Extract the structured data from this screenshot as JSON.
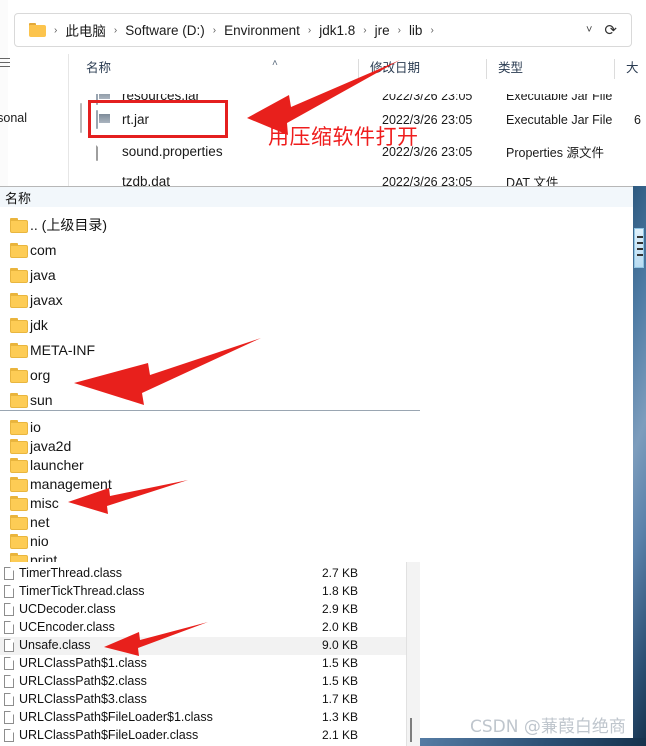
{
  "explorer": {
    "address": {
      "folder_icon": "folder-icon",
      "crumbs": [
        "此电脑",
        "Software (D:)",
        "Environment",
        "jdk1.8",
        "jre",
        "lib"
      ],
      "separator": "›",
      "dropdown_icon": "chevron-down-icon",
      "refresh_icon": "refresh-icon"
    },
    "nav_pane": {
      "hamburger_icon": "hamburger-icon",
      "partial_label": "ersonal"
    },
    "columns": [
      {
        "label": "名称",
        "sort_caret": "˄"
      },
      {
        "label": "修改日期"
      },
      {
        "label": "类型"
      },
      {
        "label": "大"
      }
    ],
    "rows": [
      {
        "icon": "jar-file-icon",
        "name": "resources.jar",
        "date": "2022/3/26 23:05",
        "type": "Executable Jar File",
        "size": ""
      },
      {
        "icon": "jar-file-icon",
        "name": "rt.jar",
        "date": "2022/3/26 23:05",
        "type": "Executable Jar File",
        "size": "6"
      },
      {
        "icon": "document-icon",
        "name": "sound.properties",
        "date": "2022/3/26 23:05",
        "type": "Properties 源文件",
        "size": ""
      },
      {
        "icon": "blue-globe-icon",
        "name": "tzdb.dat",
        "date": "2022/3/26 23:05",
        "type": "DAT 文件",
        "size": ""
      }
    ]
  },
  "annotation": {
    "text": "用压缩软件打开",
    "color": "#ef1d1d",
    "highlight_box_target": "rt.jar"
  },
  "archive_root": {
    "header": "名称",
    "items": [
      {
        "icon": "folder-icon",
        "name": ".. (上级目录)"
      },
      {
        "icon": "folder-icon",
        "name": "com"
      },
      {
        "icon": "folder-icon",
        "name": "java"
      },
      {
        "icon": "folder-icon",
        "name": "javax"
      },
      {
        "icon": "folder-icon",
        "name": "jdk"
      },
      {
        "icon": "folder-icon",
        "name": "META-INF"
      },
      {
        "icon": "folder-icon",
        "name": "org"
      },
      {
        "icon": "folder-icon",
        "name": "sun"
      }
    ]
  },
  "sun_subfolders": {
    "items": [
      {
        "icon": "folder-icon",
        "name": "io"
      },
      {
        "icon": "folder-icon",
        "name": "java2d"
      },
      {
        "icon": "folder-icon",
        "name": "launcher"
      },
      {
        "icon": "folder-icon",
        "name": "management"
      },
      {
        "icon": "folder-icon",
        "name": "misc"
      },
      {
        "icon": "folder-icon",
        "name": "net"
      },
      {
        "icon": "folder-icon",
        "name": "nio"
      },
      {
        "icon": "folder-icon",
        "name": "print"
      }
    ]
  },
  "class_files": {
    "items": [
      {
        "icon": "file-icon",
        "name": "TimerThread.class",
        "size": "2.7 KB",
        "selected": false
      },
      {
        "icon": "file-icon",
        "name": "TimerTickThread.class",
        "size": "1.8 KB",
        "selected": false
      },
      {
        "icon": "file-icon",
        "name": "UCDecoder.class",
        "size": "2.9 KB",
        "selected": false
      },
      {
        "icon": "file-icon",
        "name": "UCEncoder.class",
        "size": "2.0 KB",
        "selected": false
      },
      {
        "icon": "file-icon",
        "name": "Unsafe.class",
        "size": "9.0 KB",
        "selected": true
      },
      {
        "icon": "file-icon",
        "name": "URLClassPath$1.class",
        "size": "1.5 KB",
        "selected": false
      },
      {
        "icon": "file-icon",
        "name": "URLClassPath$2.class",
        "size": "1.5 KB",
        "selected": false
      },
      {
        "icon": "file-icon",
        "name": "URLClassPath$3.class",
        "size": "1.7 KB",
        "selected": false
      },
      {
        "icon": "file-icon",
        "name": "URLClassPath$FileLoader$1.class",
        "size": "1.3 KB",
        "selected": false
      },
      {
        "icon": "file-icon",
        "name": "URLClassPath$FileLoader.class",
        "size": "2.1 KB",
        "selected": false
      }
    ]
  },
  "watermark": {
    "text": "CSDN @蒹葭白绝商"
  },
  "colors": {
    "annotation_red": "#e41f1f",
    "folder_yellow": "#fdcc55",
    "selection_gray": "#f2f2f2",
    "wallpaper_blue": "#4e7ba4"
  }
}
